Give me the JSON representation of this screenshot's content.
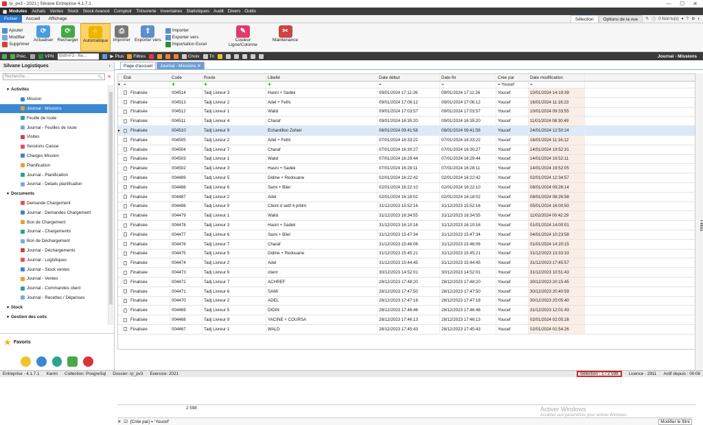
{
  "window": {
    "title": "rp_pv3 - 2021 | Silvane Entreprise 4.1.7.1"
  },
  "menu": {
    "modules": "Modules",
    "items": [
      "Achats",
      "Ventes",
      "Stock",
      "Stock Avancé",
      "Comptoir",
      "Trésorerie",
      "Inventaires",
      "Statistiques",
      "Audit",
      "Divers",
      "Outils"
    ]
  },
  "ribbon_tabs": {
    "tabs": [
      "Fichier",
      "Accueil",
      "Affichage"
    ],
    "selection": "Sélection",
    "options": "Options de la vue",
    "unread": "0 Non lu(s)"
  },
  "ribbon": {
    "ajouter": "Ajouter",
    "modifier": "Modifier",
    "supprimer": "Supprimer",
    "actualiser": "Actualiser",
    "recharger": "Recharger",
    "automatique": "Automatique",
    "imprimer": "Imprimer",
    "exporter": "Exporter vers",
    "importer": "Importer",
    "exporter_vers": "Exporter vers",
    "import_excel": "Importation Excel",
    "couleur": "Couleur Ligne/Colonne",
    "maintenance": "Maintenance"
  },
  "toolbar2": {
    "prec": "Préc.",
    "vpn": "VPN",
    "shortcut": "Shift+F3 - Re...",
    "plus": "Plus",
    "filtres": "Filtres",
    "choix": "Choix",
    "tri": "Tri",
    "title": "Journal - Missions"
  },
  "sidebar": {
    "title": "Silvane Logistiques",
    "search_placeholder": "Recherche...",
    "items": [
      {
        "label": "Activités",
        "cat": true
      },
      {
        "label": "Mission"
      },
      {
        "label": "Journal - Missions",
        "selected": true
      },
      {
        "label": "Feuille de route"
      },
      {
        "label": "Journal - Feuilles de route"
      },
      {
        "label": "Visites"
      },
      {
        "label": "Sessions Caisse"
      },
      {
        "label": "Charges Mission"
      },
      {
        "label": "Planification"
      },
      {
        "label": "Journal - Planification"
      },
      {
        "label": "Journal - Details planification"
      },
      {
        "label": "Documents",
        "cat": true
      },
      {
        "label": "Demande Chargement"
      },
      {
        "label": "Journal - Demandes Chargement"
      },
      {
        "label": "Bon de Chargement"
      },
      {
        "label": "Journal - Chargements"
      },
      {
        "label": "Bon de Déchargement"
      },
      {
        "label": "Journal - Déchargements"
      },
      {
        "label": "Journal - Logistiques"
      },
      {
        "label": "Journal - Stock ventes"
      },
      {
        "label": "Journal - Ventes"
      },
      {
        "label": "Journal - Commandes client"
      },
      {
        "label": "Journal - Recettes / Dépenses"
      },
      {
        "label": "Stock",
        "cat": true
      },
      {
        "label": "Gestion des colis",
        "cat": true
      }
    ],
    "favoris": "Favoris"
  },
  "doc_tabs": [
    "Page d'accueil",
    "Journal - Missions"
  ],
  "grid": {
    "columns": [
      "Etat",
      "Code",
      "Route",
      "Libellé",
      "Date début",
      "Date fin",
      "Crée par",
      "Date modification"
    ],
    "filter_creepar": "Youcef",
    "rows": [
      [
        "Finalisée",
        "004514",
        "Tadj Livreur 3",
        "Hasni + Sadek",
        "09/01/2024 17:11:26",
        "09/01/2024 17:11:26",
        "Youcef",
        "10/01/2024 14:19:39"
      ],
      [
        "Finalisée",
        "004513",
        "Tadj Livreur 2",
        "Adel + Fethi",
        "09/01/2024 17:06:12",
        "09/01/2024 17:06:12",
        "Youcef",
        "16/01/2024 11:16:23"
      ],
      [
        "Finalisée",
        "004512",
        "Tadj Livreur 1",
        "Walid",
        "09/01/2024 17:03:57",
        "09/01/2024 17:03:57",
        "Youcef",
        "10/01/2024 09:33:55"
      ],
      [
        "Finalisée",
        "004511",
        "Tadj Livreur 4",
        "Charaf",
        "09/01/2024 16:35:20",
        "09/01/2024 16:35:20",
        "Youcef",
        "11/01/2024 08:30:49"
      ],
      [
        "Finalisée",
        "004510",
        "Tadj Livreur 9",
        "Echantillon Zoheir",
        "08/01/2024 09:41:58",
        "08/01/2024 09:41:58",
        "Youcef",
        "24/01/2024 12:50:24"
      ],
      [
        "Finalisée",
        "004505",
        "Tadj Livreur 2",
        "Adel + Fethi",
        "07/01/2024 16:33:22",
        "07/01/2024 16:33:22",
        "Youcef",
        "16/01/2024 11:16:12"
      ],
      [
        "Finalisée",
        "004504",
        "Tadj Livreur 7",
        "Charaf",
        "07/01/2024 16:30:27",
        "07/01/2024 16:30:27",
        "Youcef",
        "14/01/2024 19:52:31"
      ],
      [
        "Finalisée",
        "004503",
        "Tadj Livreur 1",
        "Walid",
        "07/01/2024 16:29:44",
        "07/01/2024 16:29:44",
        "Youcef",
        "14/01/2024 19:52:11"
      ],
      [
        "Finalisée",
        "004502",
        "Tadj Livreur 3",
        "Hasni + Sadek",
        "07/01/2024 16:28:11",
        "07/01/2024 16:28:11",
        "Youcef",
        "14/01/2024 19:52:05"
      ],
      [
        "Finalisée",
        "004489",
        "Tadj Livreur 5",
        "Didine + Redouane",
        "02/01/2024 16:22:42",
        "02/01/2024 16:22:42",
        "Youcef",
        "02/01/2024 12:34:57"
      ],
      [
        "Finalisée",
        "004488",
        "Tadj Livreur 6",
        "Sami + Bilel",
        "02/01/2024 16:22:10",
        "02/01/2024 16:22:10",
        "Youcef",
        "08/01/2024 09:26:14"
      ],
      [
        "Finalisée",
        "004487",
        "Tadj Livreur 2",
        "Adel",
        "02/01/2024 16:18:02",
        "02/01/2024 16:18:02",
        "Youcef",
        "08/01/2024 08:26:58"
      ],
      [
        "Finalisée",
        "004486",
        "Tadj Livreur 9",
        "Client d setif 4 prblm",
        "31/12/2023 15:52:16",
        "31/12/2023 15:52:16",
        "Youcef",
        "05/01/2024 16:00:50"
      ],
      [
        "Finalisée",
        "004479",
        "Tadj Livreur 1",
        "Walid",
        "31/12/2023 16:34:55",
        "31/12/2023 16:34:55",
        "Youcef",
        "11/02/2024 00:42:29"
      ],
      [
        "Finalisée",
        "004478",
        "Tadj Livreur 3",
        "Hasni + Sadek",
        "31/12/2023 16:10:16",
        "31/12/2023 16:10:16",
        "Youcef",
        "01/01/2024 14:00:01"
      ],
      [
        "Finalisée",
        "004477",
        "Tadj Livreur 6",
        "Sami + Bilel",
        "31/12/2023 15:47:34",
        "31/12/2023 15:47:34",
        "Youcef",
        "04/01/2024 10:23:58"
      ],
      [
        "Finalisée",
        "004476",
        "Tadj Livreur 7",
        "Charaf",
        "31/12/2023 15:46:06",
        "31/12/2023 15:46:06",
        "Youcef",
        "01/01/2024 14:20:15"
      ],
      [
        "Finalisée",
        "004475",
        "Tadj Livreur 5",
        "Didine + Redouane",
        "31/12/2023 15:45:21",
        "31/12/2023 15:45:21",
        "Youcef",
        "31/12/2023 13:33:33"
      ],
      [
        "Finalisée",
        "004474",
        "Tadj Livreur 2",
        "Adel",
        "31/12/2023 15:44:45",
        "31/12/2023 15:44:45",
        "Youcef",
        "31/12/2023 17:45:57"
      ],
      [
        "Finalisée",
        "004473",
        "Tadj Livreur 9",
        "client",
        "30/12/2023 14:52:01",
        "30/12/2023 14:52:01",
        "Youcef",
        "31/12/2023 10:51:43"
      ],
      [
        "Finalisée",
        "004472",
        "Tadj Livreur 7",
        "ACHREF",
        "28/12/2023 17:48:20",
        "28/12/2023 17:48:20",
        "Youcef",
        "30/12/2023 20:15:45"
      ],
      [
        "Finalisée",
        "004471",
        "Tadj Livreur 6",
        "SAMI",
        "28/12/2023 17:47:50",
        "28/12/2023 17:47:50",
        "Youcef",
        "30/12/2023 20:40:59"
      ],
      [
        "Finalisée",
        "004470",
        "Tadj Livreur 2",
        "ADEL",
        "28/12/2023 17:47:18",
        "28/12/2023 17:47:18",
        "Youcef",
        "30/12/2023 20:05:40"
      ],
      [
        "Finalisée",
        "004469",
        "Tadj Livreur 5",
        "DIDIN",
        "28/12/2023 17:46:46",
        "28/12/2023 17:46:46",
        "Youcef",
        "31/12/2023 12:01:43"
      ],
      [
        "Finalisée",
        "004468",
        "Tadj Livreur 9",
        "YACINE + COURSA",
        "28/12/2023 17:46:13",
        "28/12/2023 17:46:13",
        "Youcef",
        "02/01/2024 02:05:28"
      ],
      [
        "Finalisée",
        "004467",
        "Tadj Livreur 1",
        "WALD",
        "28/12/2023 17:45:43",
        "28/12/2023 17:45:43",
        "Youcef",
        "02/01/2024 01:54:26"
      ]
    ],
    "count": "2 598",
    "filter_expr": "[Crée par] = 'Youcef'",
    "modify_filter": "Modifier le filtre"
  },
  "watermark": {
    "l1": "Activer Windows",
    "l2": "Accédez aux paramètres pour activer Windows."
  },
  "status": {
    "version": "Entreprise - 4.1.7.1",
    "user": "Karim",
    "collection": "Collection: PosgreSql",
    "dossier": "Dossier: rp_pv3",
    "exercice": "Exercice: 2021",
    "selection": "Sélection : 1 / 2 598",
    "licence": "Licence - 2911",
    "actif": "Actif depuis : 00:06"
  },
  "filtres_side": "Filtres",
  "colors": {
    "accent": "#2b79d0",
    "selected": "#3a87d4",
    "highlight": "#fbd36b",
    "status_border": "#dd2222"
  }
}
